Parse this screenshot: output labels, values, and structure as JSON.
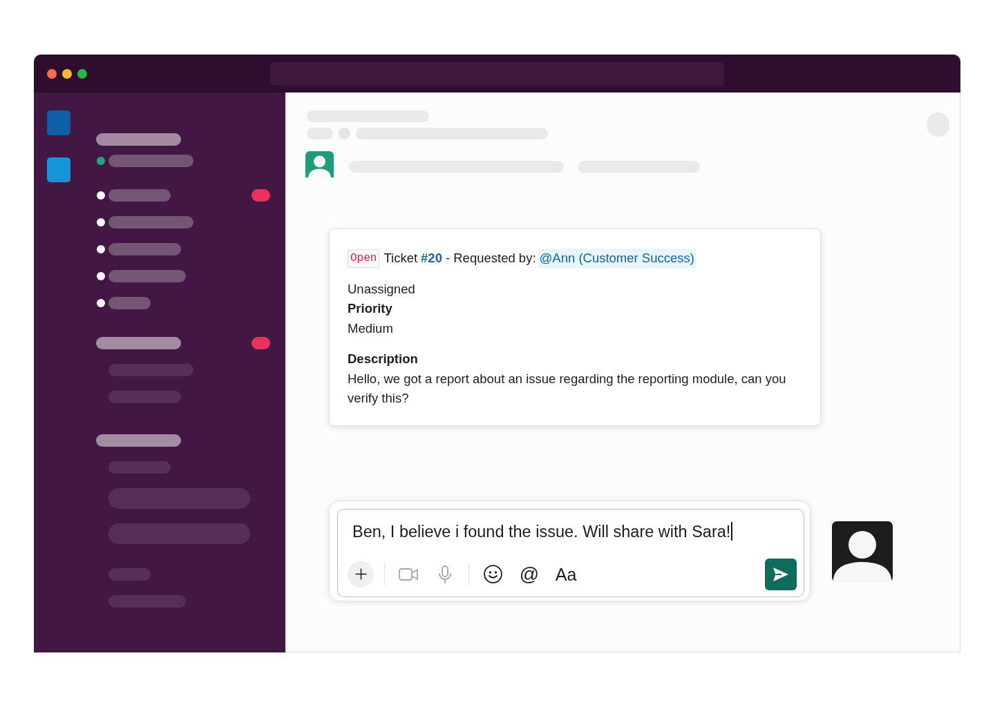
{
  "sidebar": {
    "workspaces": [
      {
        "color": "#0e5fa8"
      },
      {
        "color": "#1594d8"
      }
    ],
    "sections": [
      {
        "items": [
          {
            "kind": "header",
            "badge": false
          },
          {
            "kind": "dot",
            "color": "#22a57a",
            "badge": false
          }
        ]
      },
      {
        "items": [
          {
            "kind": "dot",
            "color": "#ffffff",
            "badge": true
          },
          {
            "kind": "dot",
            "color": "#ffffff",
            "badge": false
          },
          {
            "kind": "dot",
            "color": "#ffffff",
            "badge": false
          },
          {
            "kind": "dot",
            "color": "#ffffff",
            "badge": false
          },
          {
            "kind": "dot",
            "color": "#ffffff",
            "badge": false
          }
        ]
      },
      {
        "items": [
          {
            "kind": "header",
            "badge": true
          },
          {
            "kind": "plain",
            "badge": false
          },
          {
            "kind": "plain",
            "badge": false
          }
        ]
      },
      {
        "items": [
          {
            "kind": "header",
            "badge": false
          },
          {
            "kind": "plain",
            "badge": false
          },
          {
            "kind": "block",
            "badge": false
          },
          {
            "kind": "block",
            "badge": false
          }
        ]
      },
      {
        "items": [
          {
            "kind": "plain",
            "badge": false
          },
          {
            "kind": "plain",
            "badge": false
          }
        ]
      }
    ]
  },
  "channel_header": {
    "loading": true
  },
  "message": {
    "loading": true,
    "ticket": {
      "status": "Open",
      "title": "Ticket",
      "number": "#20",
      "requested_by_label": "- Requested by:",
      "requester": "@Ann (Customer Success)",
      "fields": [
        {
          "kind": "value",
          "text": "Unassigned"
        },
        {
          "kind": "label",
          "text": "Priority"
        },
        {
          "kind": "value",
          "text": "Medium"
        }
      ],
      "description_label": "Description",
      "description": "Hello, we got a report about an issue regarding the reporting module, can you verify this?"
    }
  },
  "composer": {
    "value": "Ben, I believe i found the issue. Will share with Sara!",
    "focused": true,
    "toolbar": [
      {
        "tools": [
          {
            "kind": "add",
            "disabled": false
          }
        ]
      },
      {
        "tools": [
          {
            "kind": "video",
            "disabled": true
          },
          {
            "kind": "microphone",
            "disabled": true
          }
        ]
      },
      {
        "tools": [
          {
            "kind": "emoji",
            "disabled": false
          },
          {
            "kind": "mention",
            "label": "@",
            "disabled": false
          },
          {
            "kind": "format",
            "label": "Aa",
            "disabled": false
          }
        ]
      }
    ],
    "send": {
      "disabled": false
    }
  }
}
